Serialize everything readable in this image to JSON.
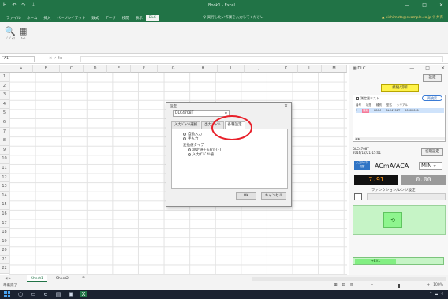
{
  "titlebar": {
    "qat": [
      "H",
      "↶",
      "↷",
      "⇣"
    ],
    "doc_title": "Book1 - Excel",
    "win_controls": [
      "—",
      "□",
      "✕"
    ],
    "tabs": [
      "ファイル",
      "ホーム",
      "挿入",
      "ページレイアウト",
      "数式",
      "データ",
      "校閲",
      "表示",
      "DLC"
    ],
    "active_tab_index": 8,
    "tell_me": "♀ 実行したい作業を入力してください",
    "account": "▲ kishimoto@example.co.jp  ⚲ 共有"
  },
  "ribbon": {
    "groups": [
      {
        "glyph": "🔍",
        "label": "ﾃﾞﾊﾞｲｽ"
      },
      {
        "glyph": "▦",
        "label": "ﾂｰﾙ"
      }
    ]
  },
  "formula_bar": {
    "name_box": "A1",
    "fx": "×  ✓  fx"
  },
  "grid": {
    "columns": [
      "A",
      "B",
      "C",
      "D",
      "E",
      "F",
      "G",
      "H",
      "I",
      "J",
      "K",
      "L",
      "M"
    ],
    "rows": [
      "1",
      "2",
      "3",
      "4",
      "5",
      "6",
      "7",
      "8",
      "9",
      "10",
      "11",
      "12",
      "13",
      "14",
      "15",
      "16",
      "17",
      "18",
      "19",
      "20",
      "21",
      "22"
    ]
  },
  "dialog": {
    "title": "設定",
    "close": "✕",
    "device_select": "DLC4708T",
    "tabs": [
      "入力ｼﾞｬﾝﾙ選択",
      "出力ｼﾞｬﾝﾙ",
      "各種設定"
    ],
    "active_tab": 2,
    "options": [
      {
        "label": "自動入力",
        "on": true
      },
      {
        "label": "手入力",
        "on": false
      }
    ],
    "group_label": "変換値タイプ",
    "group_options": [
      {
        "label": "測定値＋±Fr/F(F)",
        "on": false
      },
      {
        "label": "入力ﾎﾟｼﾞﾅﾙ値",
        "on": true
      }
    ],
    "ok": "OK",
    "cancel": "キャンセル"
  },
  "pane": {
    "title": "DLC",
    "controls": [
      "—",
      "□",
      "✕"
    ],
    "settings_btn": "設定",
    "connect_btn": "接続/切断",
    "list": {
      "caption": "測定器リスト",
      "reconnect": "再検索",
      "columns": [
        "番号",
        "状態",
        "種別",
        "型名",
        "シリアル"
      ],
      "row": [
        "1",
        "接続",
        "DMM",
        "DLC4708T",
        "00000001"
      ]
    },
    "device_info": [
      "DLC4708T",
      "2016/12/21-15:01"
    ],
    "reset_btn": "初期設定",
    "measure_btn": "入力ﾁｬﾝﾈﾙ 切替",
    "function": "ACmA/ACA",
    "range": "MIN",
    "display_left": "7.91",
    "display_right": "0.00",
    "function_label": "ファンクション/レンジ設定",
    "capture_icon": "⟲",
    "exl_btn": "→EXL"
  },
  "sheets": {
    "nav": "◀ ▶",
    "tabs": [
      "Sheet1",
      "Sheet2"
    ],
    "active": 0,
    "add": "⊕"
  },
  "status": {
    "ready": "準備完了",
    "views": [
      "▦",
      "▤",
      "▥"
    ],
    "zoom": "100%"
  },
  "colors": {
    "excel_green": "#217346",
    "highlight_red": "#e8202a",
    "display_orange": "#ff9a1a",
    "yellow_button": "#fff34a",
    "green_panel": "#c6f4c6"
  }
}
